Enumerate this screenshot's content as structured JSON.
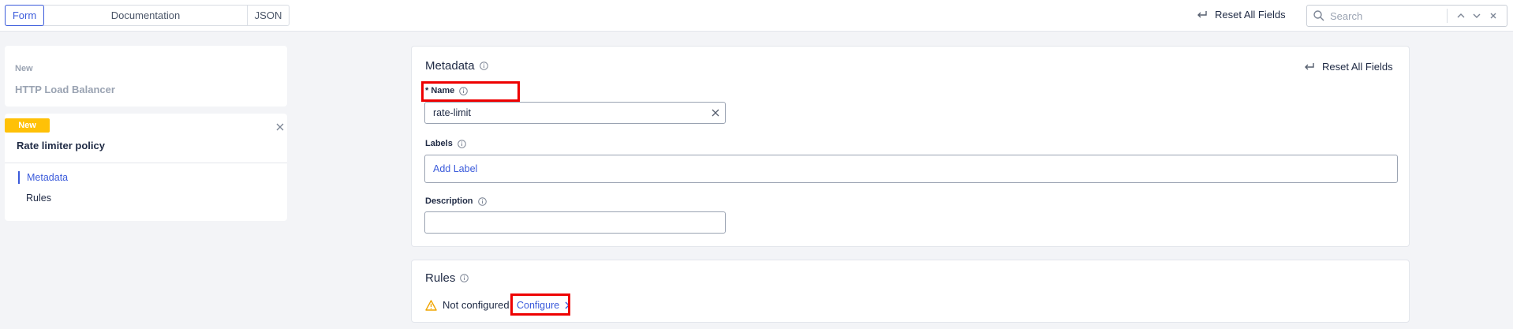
{
  "toolbar": {
    "modes": [
      "Form",
      "Documentation",
      "JSON"
    ],
    "reset_label": "Reset All Fields",
    "search_placeholder": "Search"
  },
  "sidebar": {
    "parent": {
      "badge": "New",
      "title": "HTTP Load Balancer"
    },
    "current": {
      "badge": "New",
      "title": "Rate limiter policy",
      "nav": [
        {
          "label": "Metadata",
          "active": true
        },
        {
          "label": "Rules",
          "active": false
        }
      ]
    }
  },
  "metadata": {
    "title": "Metadata",
    "reset_label": "Reset All Fields",
    "name_label": "* Name",
    "name_value": "rate-limit",
    "labels_label": "Labels",
    "add_label": "Add Label",
    "description_label": "Description",
    "description_value": ""
  },
  "rules": {
    "title": "Rules",
    "status": "Not configured",
    "configure_label": "Configure"
  },
  "colors": {
    "accent": "#3b5bdb",
    "badge": "#ffc107",
    "highlight": "#ee0000",
    "warning": "#f0a500"
  }
}
